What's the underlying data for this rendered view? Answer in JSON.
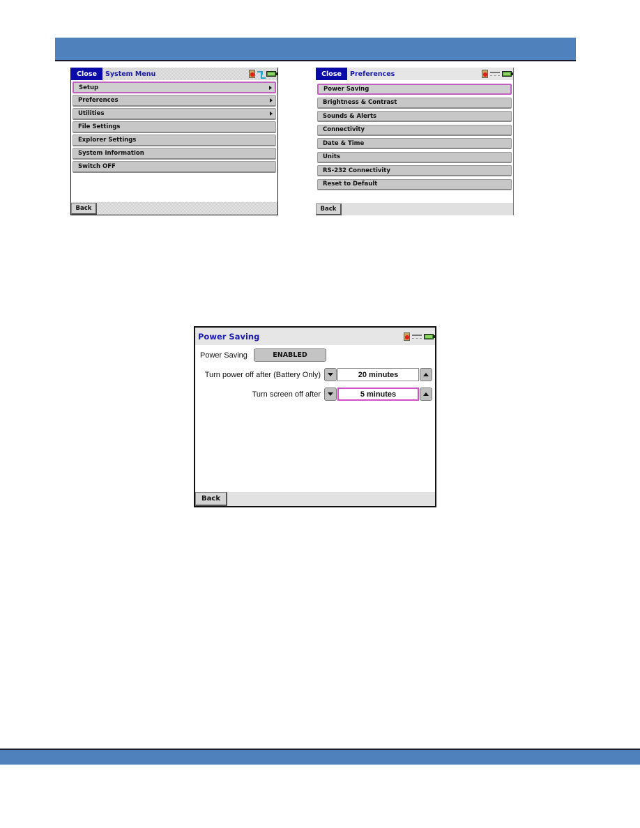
{
  "system_menu": {
    "close_label": "Close",
    "title": "System Menu",
    "status_icons": [
      "sd-card-icon",
      "usb-icon",
      "battery-icon"
    ],
    "items": [
      {
        "label": "Setup",
        "has_submenu": true,
        "selected": true
      },
      {
        "label": "Preferences",
        "has_submenu": true,
        "selected": false
      },
      {
        "label": "Utilities",
        "has_submenu": true,
        "selected": false
      },
      {
        "label": "File Settings",
        "has_submenu": false,
        "selected": false
      },
      {
        "label": "Explorer Settings",
        "has_submenu": false,
        "selected": false
      },
      {
        "label": "System Information",
        "has_submenu": false,
        "selected": false
      },
      {
        "label": "Switch OFF",
        "has_submenu": false,
        "selected": false
      }
    ],
    "back_label": "Back"
  },
  "preferences": {
    "close_label": "Close",
    "title": "Preferences",
    "status_icons": [
      "sd-card-icon",
      "connection-icon",
      "battery-icon"
    ],
    "items": [
      {
        "label": "Power Saving",
        "selected": true
      },
      {
        "label": "Brightness & Contrast",
        "selected": false
      },
      {
        "label": "Sounds & Alerts",
        "selected": false
      },
      {
        "label": "Connectivity",
        "selected": false
      },
      {
        "label": "Date & Time",
        "selected": false
      },
      {
        "label": "Units",
        "selected": false
      },
      {
        "label": "RS-232 Connectivity",
        "selected": false
      },
      {
        "label": "Reset to Default",
        "selected": false
      }
    ],
    "back_label": "Back"
  },
  "power_saving": {
    "title": "Power Saving",
    "status_icons": [
      "sd-card-icon",
      "connection-icon",
      "battery-icon"
    ],
    "power_saving_label": "Power Saving",
    "power_saving_value": "ENABLED",
    "power_off_label": "Turn power off after (Battery Only)",
    "power_off_value": "20 minutes",
    "screen_off_label": "Turn screen off after",
    "screen_off_value": "5 minutes",
    "back_label": "Back"
  },
  "colors": {
    "banner": "#4f81bd",
    "close_button": "#0a0aa8",
    "title_text": "#1a1ab0",
    "selection_outline": "#c060c0"
  }
}
